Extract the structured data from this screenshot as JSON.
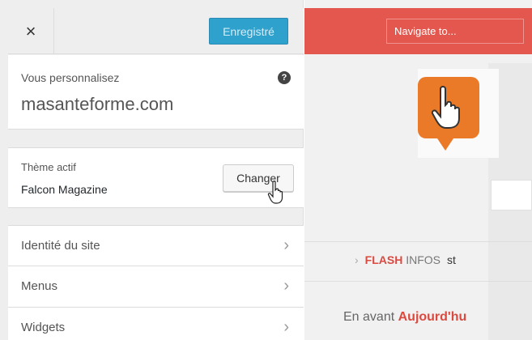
{
  "toolbar": {
    "close_glyph": "×",
    "save_label": "Enregistré"
  },
  "info": {
    "label": "Vous personnalisez",
    "site_name": "masanteforme.com",
    "help_glyph": "?"
  },
  "theme": {
    "label": "Thème actif",
    "name": "Falcon Magazine",
    "change_label": "Changer"
  },
  "menu": {
    "chevron_glyph": "›",
    "items": [
      {
        "label": "Identité du site"
      },
      {
        "label": "Menus"
      },
      {
        "label": "Widgets"
      }
    ]
  },
  "preview": {
    "nav_label": "Navigate to...",
    "flash_arrow": "›",
    "flash_hot": "FLASH",
    "flash_rest": "INFOS",
    "flash_tail": "st",
    "avant_text": "En avant",
    "avant_hot": "Aujourd'hu"
  },
  "colors": {
    "save_button": "#2ea2cc",
    "nav_bar": "#e4574e",
    "logo": "#ea7a28",
    "accent_text": "#d94a40"
  },
  "icons": [
    "close-icon",
    "help-icon",
    "hand-cursor-icon",
    "chevron-right-icon",
    "hand-logo-icon"
  ]
}
